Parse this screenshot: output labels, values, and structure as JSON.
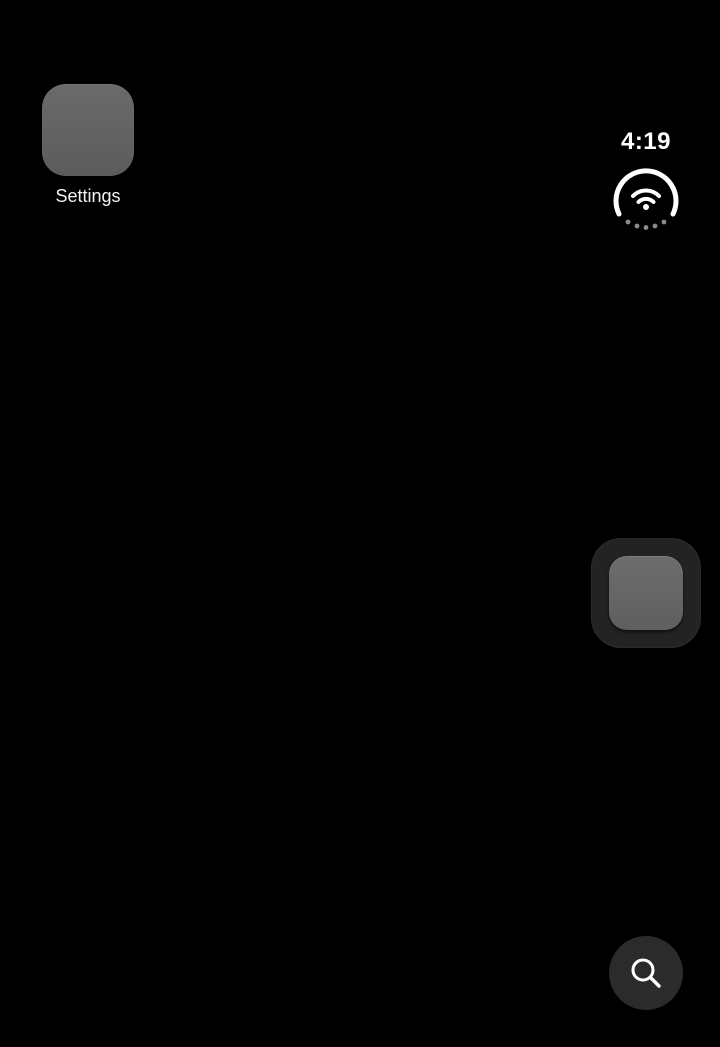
{
  "home": {
    "apps": [
      {
        "label": "Settings",
        "icon": "settings-app-icon"
      }
    ]
  },
  "status": {
    "time": "4:19",
    "connectivity_icon": "wifi-icon"
  },
  "dock": {
    "tile_icon": "app-placeholder-icon"
  },
  "search": {
    "icon": "search-icon"
  },
  "colors": {
    "background": "#000000",
    "app_icon": "#636363",
    "dock_tile": "#232323",
    "search_button": "#2b2b2b",
    "text": "#ffffff"
  }
}
